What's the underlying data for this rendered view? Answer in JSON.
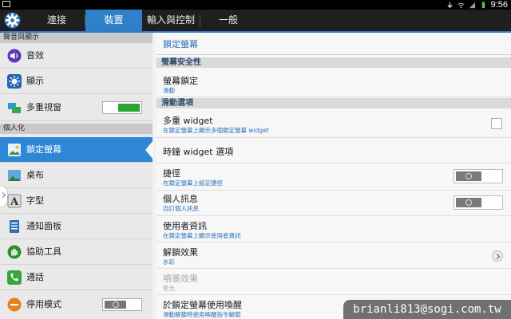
{
  "status_bar": {
    "time": "9:56",
    "icons": [
      "image-icon",
      "download-icon",
      "wifi-icon",
      "signal-icon",
      "battery-icon"
    ]
  },
  "tabs": [
    {
      "label": "連接"
    },
    {
      "label": "裝置"
    },
    {
      "label": "輸入與控制"
    },
    {
      "label": "一般"
    }
  ],
  "active_tab": "裝置",
  "sidebar": {
    "category_sound": "聲音與顯示",
    "category_personal": "個人化",
    "items": [
      {
        "label": "音效",
        "icon": "speaker-icon"
      },
      {
        "label": "顯示",
        "icon": "brightness-icon"
      },
      {
        "label": "多重視窗",
        "icon": "multiwindow-icon",
        "toggle": "on"
      },
      {
        "label": "鎖定螢幕",
        "icon": "lockscreen-icon",
        "selected": true
      },
      {
        "label": "桌布",
        "icon": "wallpaper-icon"
      },
      {
        "label": "字型",
        "icon": "font-icon"
      },
      {
        "label": "通知面板",
        "icon": "notification-panel-icon"
      },
      {
        "label": "協助工具",
        "icon": "accessibility-hand-icon"
      },
      {
        "label": "通話",
        "icon": "phone-icon"
      },
      {
        "label": "停用模式",
        "icon": "blocking-mode-icon",
        "toggle": "off"
      }
    ]
  },
  "main": {
    "title": "鎖定螢幕",
    "section_security": "螢幕安全性",
    "section_swipe": "滑動選項",
    "rows": [
      {
        "title": "螢幕鎖定",
        "subtitle": "滑動"
      },
      {
        "title": "多重 widget",
        "subtitle": "在鎖定螢幕上顯示多個鎖定螢幕 widget",
        "control": "checkbox",
        "checked": false
      },
      {
        "title": "時鐘 widget 選項",
        "subtitle": ""
      },
      {
        "title": "捷徑",
        "subtitle": "在鎖定螢幕上設定捷徑",
        "control": "switch",
        "state": "off"
      },
      {
        "title": "個人訊息",
        "subtitle": "自訂個人訊息",
        "control": "switch",
        "state": "off"
      },
      {
        "title": "使用者資訊",
        "subtitle": "在鎖定螢幕上顯示使用者資訊"
      },
      {
        "title": "解鎖效果",
        "subtitle": "水彩",
        "control": "chevron"
      },
      {
        "title": "噴墨效果",
        "subtitle": "藍色",
        "disabled": true
      },
      {
        "title": "於鎖定螢幕使用喚醒",
        "subtitle": "滑動解鎖時使用喚醒指令解鎖"
      }
    ]
  },
  "watermark": "brianli813@sogi.com.tw",
  "colors": {
    "accent": "#2f80c9",
    "selected_item": "#2d86d6",
    "toggle_on": "#2aa52f",
    "subtitle": "#2a73b9"
  }
}
